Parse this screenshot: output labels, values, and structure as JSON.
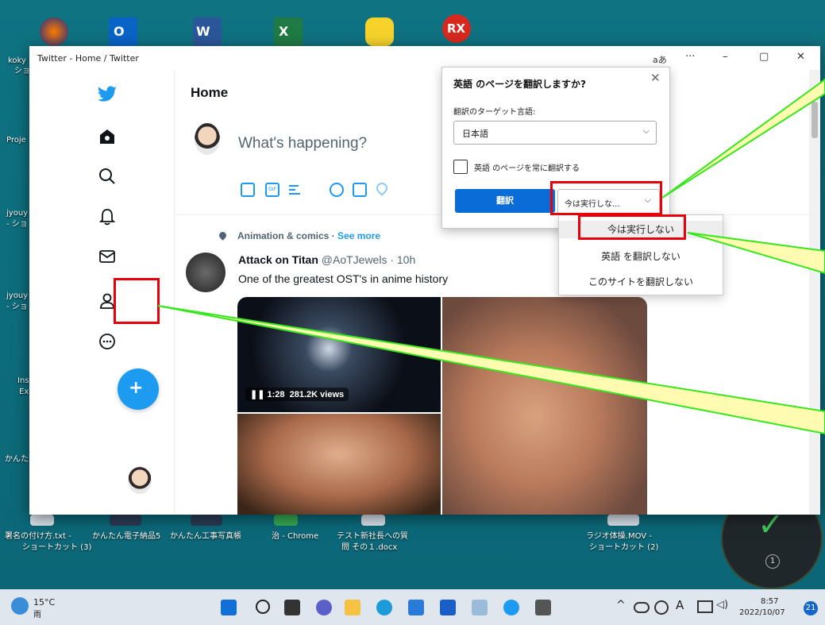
{
  "window": {
    "title": "Twitter - Home / Twitter",
    "font_btn": "aあ",
    "more_btn": "···",
    "min_btn": "–",
    "max_btn": "▢",
    "close_btn": "✕"
  },
  "twitter": {
    "home_title": "Home",
    "compose_placeholder": "What's happening?",
    "topic_line": "Animation & comics · ",
    "topic_link": "See more",
    "tweet_author": "Attack on Titan",
    "tweet_handle": "@AoTJewels · 10h",
    "tweet_text": "One of the greatest OST's in anime history",
    "video_time": "❚❚ 1:28",
    "video_views": "281.2K views",
    "accent": "#1d9bf0"
  },
  "translate": {
    "title": "英語 のページを翻訳しますか?",
    "target_label": "翻訳のターゲット言語:",
    "target_value": "日本語",
    "always_label": "英語 のページを常に翻訳する",
    "translate_btn": "翻訳",
    "not_now_btn": "今は実行しな...",
    "options": [
      "今は実行しない",
      "英語 を翻訳しない",
      "このサイトを翻訳しない"
    ]
  },
  "desktop": {
    "left_labels": [
      "koky",
      "ショ",
      "Proje",
      "jyouy",
      "- ショ",
      "jyouy",
      "- ショ",
      "Ins",
      "Ex",
      "かんた"
    ],
    "bottom_labels": [
      {
        "l1": "署名の付け方.txt -",
        "l2": "ショートカット (3)"
      },
      {
        "l1": "かんたん電子納品5",
        "l2": ""
      },
      {
        "l1": "かんたん工事写真帳",
        "l2": ""
      },
      {
        "l1": "治 - Chrome",
        "l2": ""
      },
      {
        "l1": "テスト新社長への質",
        "l2": "問 その１.docx"
      },
      {
        "l1": "ラジオ体操.MOV -",
        "l2": "ショートカット (2)"
      }
    ],
    "rx_label": "RX",
    "gauge_label": "1"
  },
  "taskbar": {
    "weather_temp": "15°C",
    "weather_desc": "雨",
    "ime": "A",
    "time": "8:57",
    "date": "2022/10/07",
    "badge": "21",
    "tray_up": "^"
  }
}
